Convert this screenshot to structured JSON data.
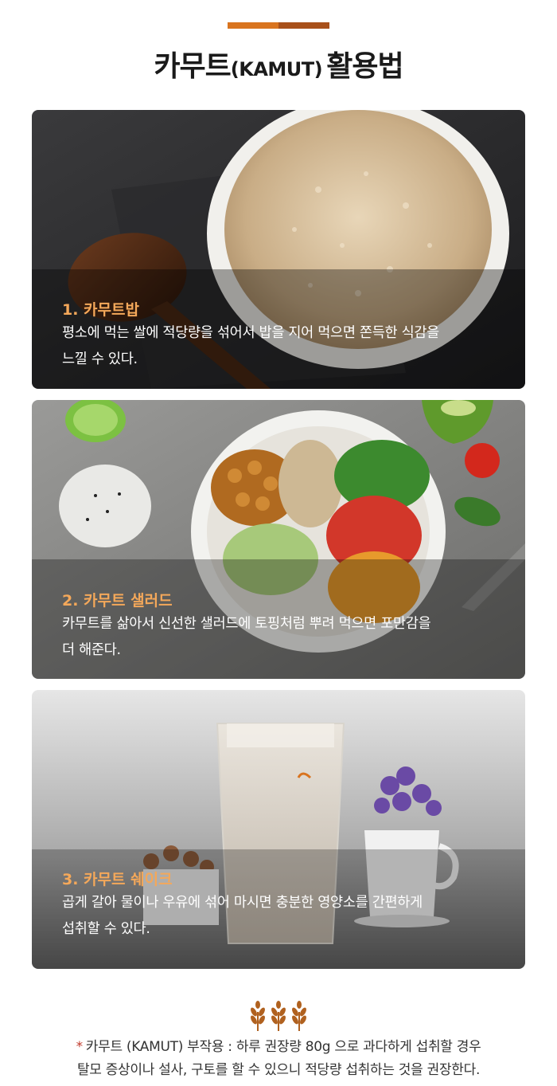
{
  "header": {
    "title_main": "카무트",
    "title_sub": "(KAMUT)",
    "title_end": "활용법"
  },
  "cards": [
    {
      "heading": "1. 카무트밥",
      "desc_line1": "평소에 먹는 쌀에 적당량을 섞어서 밥을 지어 먹으면 쫀득한 식감을",
      "desc_line2": "느낄 수 있다."
    },
    {
      "heading": "2. 카무트 샐러드",
      "desc_line1": "카무트를 삶아서 신선한 샐러드에 토핑처럼 뿌려 먹으면 포만감을",
      "desc_line2": "더 해준다."
    },
    {
      "heading": "3. 카무트 쉐이크",
      "desc_line1": "곱게 갈아 물이나 우유에 섞어 마시면 충분한 영양소를 간편하게",
      "desc_line2": "섭취할 수 있다."
    }
  ],
  "footer": {
    "star": "*",
    "line1": "카무트 (KAMUT) 부작용 : 하루 권장량 80g 으로 과다하게 섭취할 경우",
    "line2": "탈모 증상이나 설사, 구토를 할 수 있으니 적당량 섭취하는 것을 권장한다."
  },
  "colors": {
    "accent_orange": "#d9741f",
    "accent_brown": "#a8501a",
    "heading_orange": "#f4a85a",
    "wheat_icon": "#b0611f"
  },
  "icons": [
    "wheat-icon"
  ]
}
